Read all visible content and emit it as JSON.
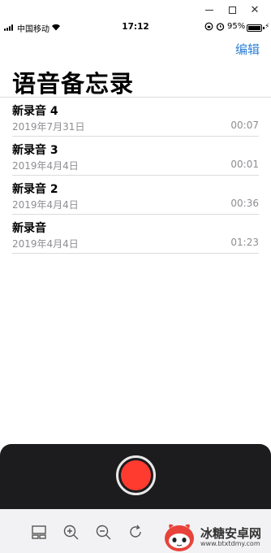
{
  "window": {
    "minimize_symbol": "–",
    "maximize_symbol": "□",
    "close_symbol": "✕"
  },
  "status_bar": {
    "carrier": "中国移动",
    "time": "17:12",
    "battery_percent": "95%",
    "icons": [
      "signal-icon",
      "wifi-icon",
      "rotation-lock-icon",
      "alarm-icon",
      "battery-icon",
      "charging-icon"
    ]
  },
  "header": {
    "edit_label": "编辑",
    "title": "语音备忘录"
  },
  "recordings": [
    {
      "title": "新录音 4",
      "date": "2019年7月31日",
      "duration": "00:07"
    },
    {
      "title": "新录音 3",
      "date": "2019年4月4日",
      "duration": "00:01"
    },
    {
      "title": "新录音 2",
      "date": "2019年4月4日",
      "duration": "00:36"
    },
    {
      "title": "新录音",
      "date": "2019年4月4日",
      "duration": "01:23"
    }
  ],
  "record_panel": {
    "record_color": "#ff3b30",
    "background": "#1c1c1e"
  },
  "toolbar": {
    "icons": [
      "layout-icon",
      "zoom-in-icon",
      "zoom-out-icon",
      "rotate-icon"
    ]
  },
  "watermark": {
    "text": "冰糖安卓网",
    "url": "www.btxtdmy.com"
  },
  "colors": {
    "accent": "#2f7fd6",
    "secondary_text": "#8e8e93",
    "divider": "#dcdcdc"
  }
}
